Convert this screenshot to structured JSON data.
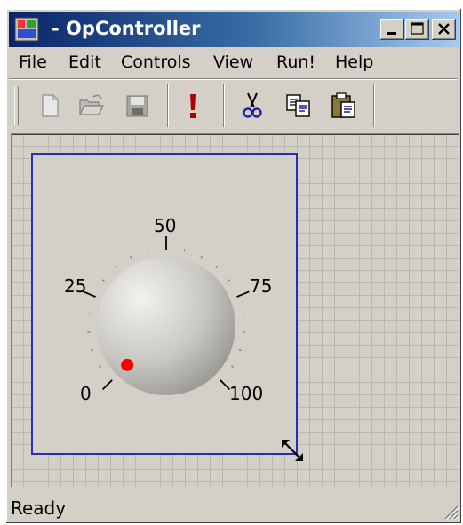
{
  "window": {
    "title": "- OpController",
    "app_icon": "app-icon",
    "caption_buttons": [
      "minimize-icon",
      "maximize-icon",
      "close-icon"
    ]
  },
  "menu": {
    "file": "File",
    "edit": "Edit",
    "controls": "Controls",
    "view": "View",
    "run": "Run!",
    "help": "Help"
  },
  "toolbar": {
    "buttons": [
      "new-file-icon",
      "open-folder-icon",
      "save-disk-icon",
      "run-exclamation-icon",
      "cut-scissors-icon",
      "copy-icon",
      "paste-icon"
    ],
    "colors": {
      "run": "#b00000",
      "scissors": "#1a1aa0"
    }
  },
  "dial": {
    "labels": {
      "min": "0",
      "q1": "25",
      "mid": "50",
      "q3": "75",
      "max": "100"
    },
    "value": 0,
    "indicator_color": "#ff0000",
    "frame_color": "#2b2bb3"
  },
  "status": {
    "text": "Ready"
  }
}
